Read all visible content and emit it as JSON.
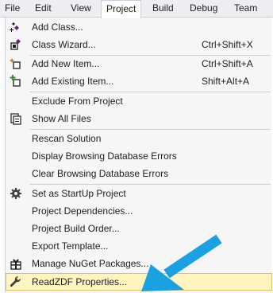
{
  "menubar": {
    "items": [
      "File",
      "Edit",
      "View",
      "Project",
      "Build",
      "Debug",
      "Team"
    ],
    "active": "Project"
  },
  "menu": {
    "add_class": {
      "label": "Add Class...",
      "icon": "add-class-icon"
    },
    "class_wizard": {
      "label": "Class Wizard...",
      "shortcut": "Ctrl+Shift+X",
      "icon": "class-wizard-icon"
    },
    "add_new_item": {
      "label": "Add New Item...",
      "shortcut": "Ctrl+Shift+A",
      "icon": "add-new-item-icon"
    },
    "add_existing_item": {
      "label": "Add Existing Item...",
      "shortcut": "Shift+Alt+A",
      "icon": "add-existing-item-icon"
    },
    "exclude": {
      "label": "Exclude From Project"
    },
    "show_all": {
      "label": "Show All Files",
      "icon": "show-all-files-icon"
    },
    "rescan": {
      "label": "Rescan Solution"
    },
    "display_errors": {
      "label": "Display Browsing Database Errors"
    },
    "clear_errors": {
      "label": "Clear Browsing Database Errors"
    },
    "startup": {
      "label": "Set as StartUp Project",
      "icon": "gear-icon"
    },
    "dependencies": {
      "label": "Project Dependencies..."
    },
    "build_order": {
      "label": "Project Build Order..."
    },
    "export_template": {
      "label": "Export Template..."
    },
    "nuget": {
      "label": "Manage NuGet Packages...",
      "icon": "nuget-package-icon"
    },
    "readzdf": {
      "label": "ReadZDF Properties...",
      "icon": "wrench-icon"
    }
  },
  "colors": {
    "menubar_bg": "#eeeef2",
    "dropdown_bg": "#f6f6f6",
    "highlight_bg": "#fdf4bf",
    "highlight_border": "#e5c365",
    "arrow": "#1ba1e2"
  }
}
